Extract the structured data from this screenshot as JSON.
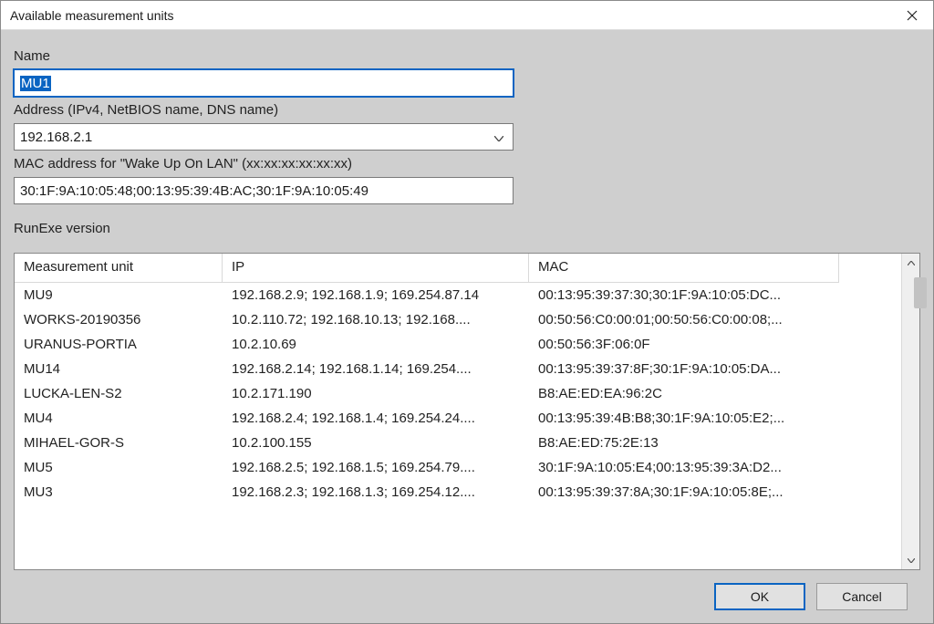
{
  "window": {
    "title": "Available measurement units"
  },
  "fields": {
    "name_label": "Name",
    "name_value": "MU1",
    "address_label": "Address (IPv4, NetBIOS name, DNS name)",
    "address_value": "192.168.2.1",
    "mac_label": "MAC address for \"Wake Up On LAN\" (xx:xx:xx:xx:xx:xx)",
    "mac_value": "30:1F:9A:10:05:48;00:13:95:39:4B:AC;30:1F:9A:10:05:49",
    "runexe_label": "RunExe version"
  },
  "table": {
    "headers": {
      "unit": "Measurement unit",
      "ip": "IP",
      "mac": "MAC"
    },
    "rows": [
      {
        "unit": "MU9",
        "ip": "192.168.2.9; 192.168.1.9; 169.254.87.14",
        "mac": "00:13:95:39:37:30;30:1F:9A:10:05:DC..."
      },
      {
        "unit": "WORKS-20190356",
        "ip": "10.2.110.72; 192.168.10.13; 192.168....",
        "mac": "00:50:56:C0:00:01;00:50:56:C0:00:08;..."
      },
      {
        "unit": "URANUS-PORTIA",
        "ip": "10.2.10.69",
        "mac": "00:50:56:3F:06:0F"
      },
      {
        "unit": "MU14",
        "ip": "192.168.2.14; 192.168.1.14; 169.254....",
        "mac": "00:13:95:39:37:8F;30:1F:9A:10:05:DA..."
      },
      {
        "unit": "LUCKA-LEN-S2",
        "ip": "10.2.171.190",
        "mac": "B8:AE:ED:EA:96:2C"
      },
      {
        "unit": "MU4",
        "ip": "192.168.2.4; 192.168.1.4; 169.254.24....",
        "mac": "00:13:95:39:4B:B8;30:1F:9A:10:05:E2;..."
      },
      {
        "unit": "MIHAEL-GOR-S",
        "ip": "10.2.100.155",
        "mac": "B8:AE:ED:75:2E:13"
      },
      {
        "unit": "MU5",
        "ip": "192.168.2.5; 192.168.1.5; 169.254.79....",
        "mac": "30:1F:9A:10:05:E4;00:13:95:39:3A:D2..."
      },
      {
        "unit": "MU3",
        "ip": "192.168.2.3; 192.168.1.3; 169.254.12....",
        "mac": "00:13:95:39:37:8A;30:1F:9A:10:05:8E;..."
      }
    ]
  },
  "buttons": {
    "ok": "OK",
    "cancel": "Cancel"
  }
}
